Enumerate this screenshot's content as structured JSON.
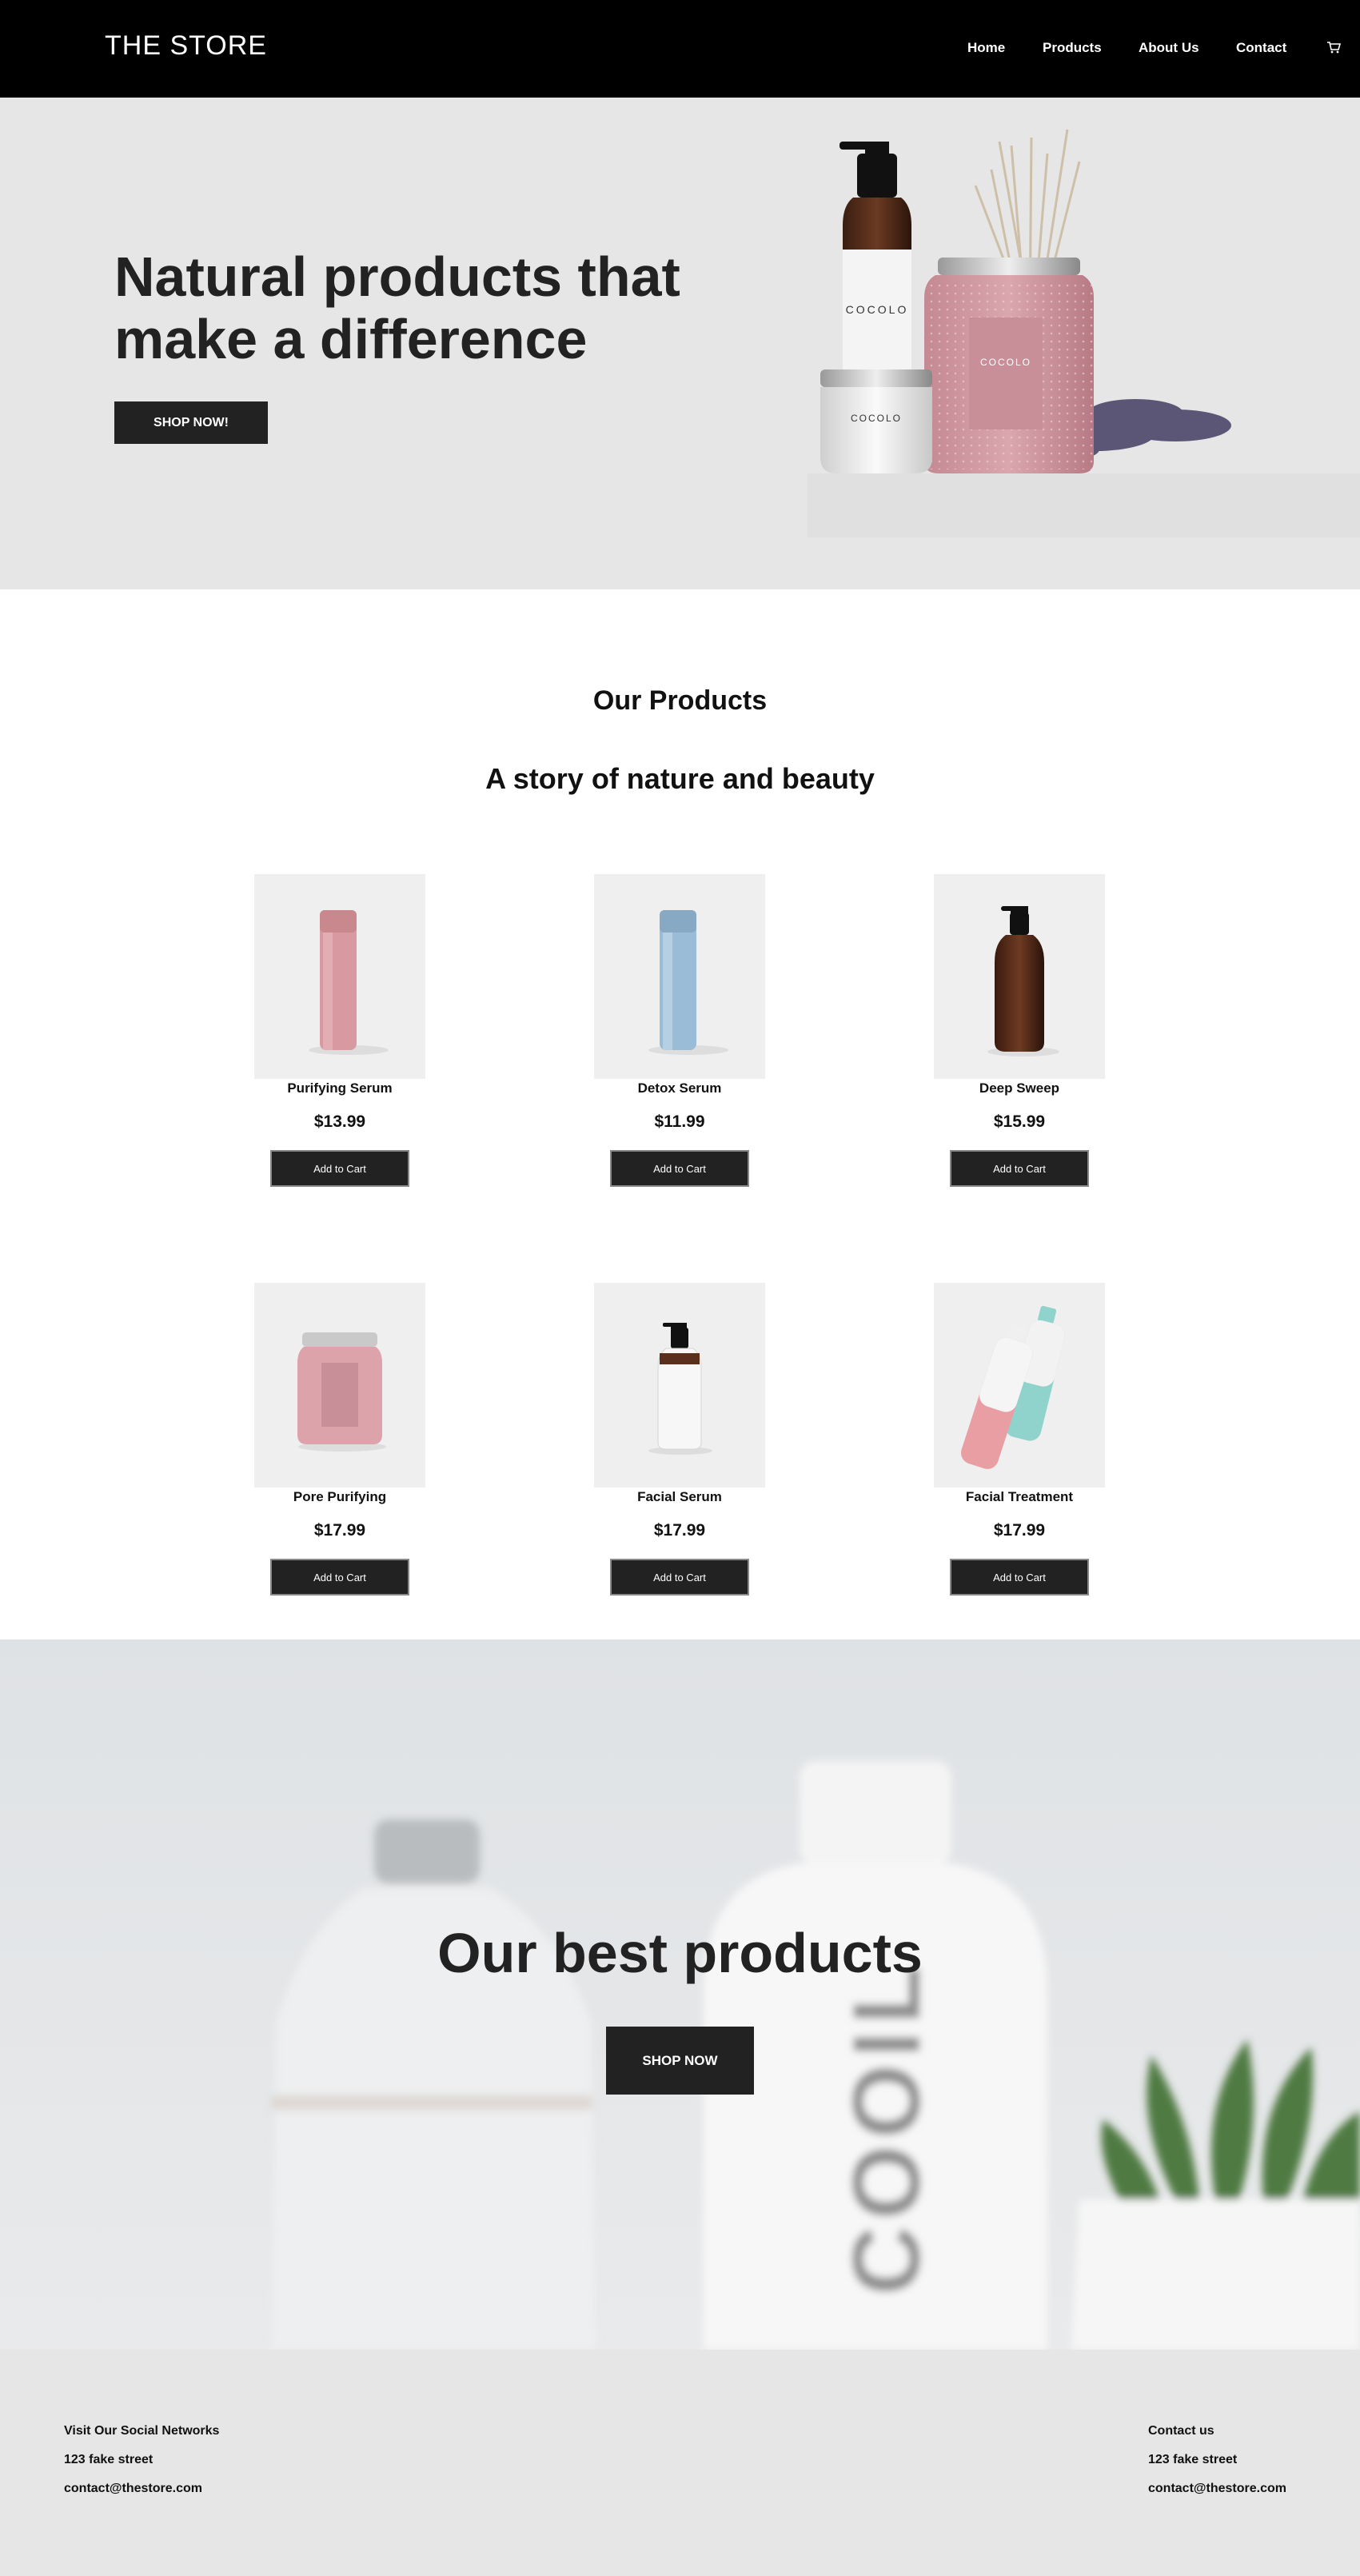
{
  "header": {
    "logo": "THE STORE",
    "nav": [
      "Home",
      "Products",
      "About Us",
      "Contact"
    ]
  },
  "hero": {
    "title": "Natural products that make a difference",
    "button": "SHOP NOW!",
    "brand_text": "COCOLO"
  },
  "products_section": {
    "title": "Our Products",
    "subtitle": "A story of nature and beauty",
    "add_to_cart_label": "Add to Cart",
    "items": [
      {
        "name": "Purifying Serum",
        "price": "$13.99"
      },
      {
        "name": "Detox Serum",
        "price": "$11.99"
      },
      {
        "name": "Deep Sweep",
        "price": "$15.99"
      },
      {
        "name": "Pore Purifying",
        "price": "$17.99"
      },
      {
        "name": "Facial Serum",
        "price": "$17.99"
      },
      {
        "name": "Facial Treatment",
        "price": "$17.99"
      }
    ]
  },
  "banner": {
    "title": "Our best products",
    "button": "SHOP NOW",
    "bottle_text": "COOIL"
  },
  "footer": {
    "left": [
      "Visit Our Social Networks",
      "123 fake street",
      "contact@thestore.com"
    ],
    "right": [
      "Contact us",
      "123 fake street",
      "contact@thestore.com"
    ]
  }
}
